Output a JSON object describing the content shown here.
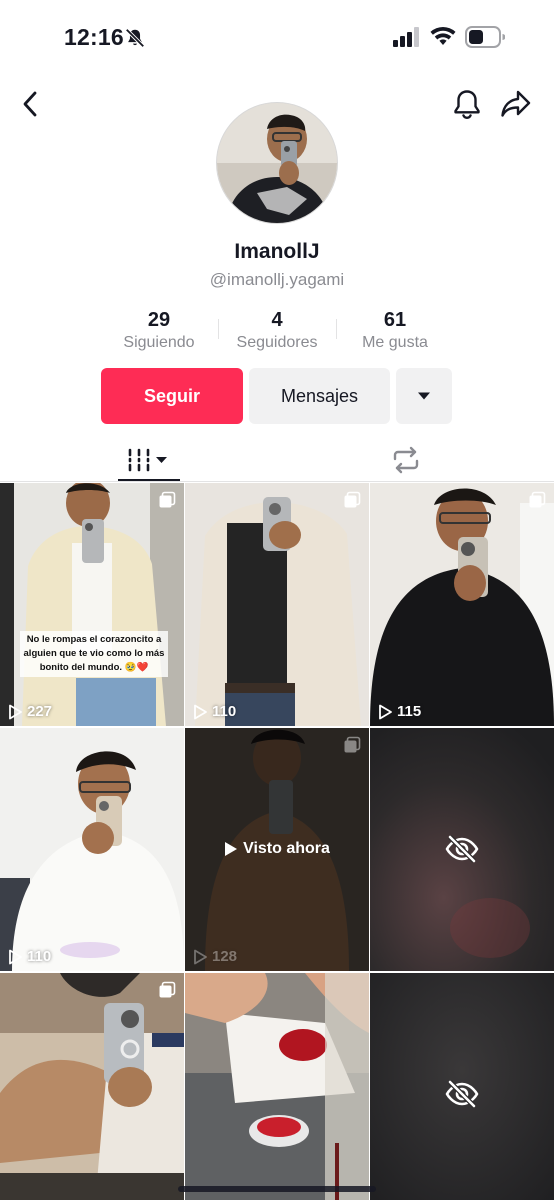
{
  "status_bar": {
    "time": "12:16"
  },
  "profile": {
    "display_name": "ImanollJ",
    "username": "@imanollj.yagami"
  },
  "stats": [
    {
      "value": "29",
      "label": "Siguiendo"
    },
    {
      "value": "4",
      "label": "Seguidores"
    },
    {
      "value": "61",
      "label": "Me gusta"
    }
  ],
  "actions": {
    "follow_label": "Seguir",
    "message_label": "Mensajes"
  },
  "colors": {
    "accent": "#fe2c55",
    "secondary_button": "#f1f1f2",
    "text_primary": "#161823",
    "text_secondary": "#8a8b91"
  },
  "tabs": [
    {
      "icon": "videos-grid-icon",
      "selected": true
    },
    {
      "icon": "repost-icon",
      "selected": false
    }
  ],
  "videos": [
    {
      "views": "227",
      "caption": "No le rompas el corazoncito a alguien que te vio como lo más bonito del mundo. 🥹❤️",
      "icon": "multi-photo-icon"
    },
    {
      "views": "110",
      "icon": "multi-photo-icon"
    },
    {
      "views": "115",
      "icon": "multi-photo-icon"
    },
    {
      "views": "110"
    },
    {
      "views": "128",
      "watched_label": "Visto ahora",
      "icon": "multi-photo-icon"
    },
    {
      "hidden": true,
      "icon": "eye-off-icon"
    },
    {
      "icon": "multi-photo-icon"
    },
    {},
    {
      "hidden": true,
      "icon": "eye-off-icon"
    }
  ]
}
